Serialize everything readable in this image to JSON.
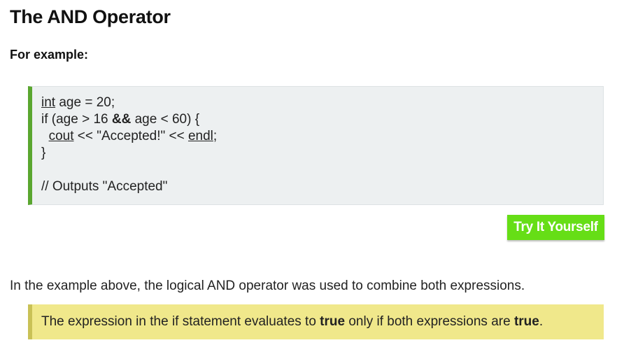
{
  "heading": "The AND Operator",
  "subheading": "For example:",
  "code": {
    "l1_kw": "int",
    "l1_rest": " age = 20;",
    "l2_a": "if (age > 16 ",
    "l2_op": "&&",
    "l2_b": " age < 60) {",
    "l3_indent": "  ",
    "l3_cout": "cout",
    "l3_mid": " << \"Accepted!\" << ",
    "l3_endl": "endl",
    "l3_end": ";",
    "l4": "}",
    "l6": "// Outputs \"Accepted\""
  },
  "button": {
    "label": "Try It Yourself"
  },
  "paragraph": "In the example above, the logical AND operator was used to combine both expressions.",
  "note": {
    "pre": "The expression in the if statement evaluates to ",
    "b1": "true",
    "mid": " only if both expressions are ",
    "b2": "true",
    "end": "."
  },
  "colors": {
    "code_border": "#5aa62f",
    "code_bg": "#edf0f1",
    "button_bg": "#66de16",
    "note_bg": "#f0e88b",
    "note_border": "#c9c156"
  }
}
